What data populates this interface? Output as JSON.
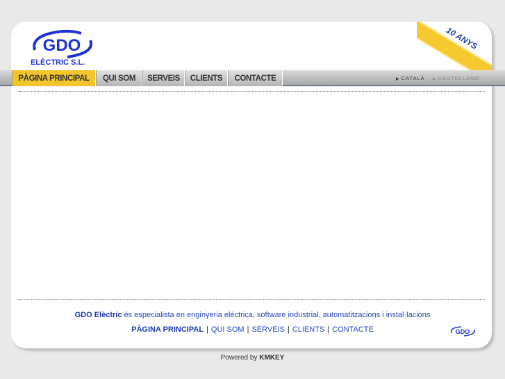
{
  "brand": {
    "logo_text": "GDO",
    "subtitle": "ELÈCTRIC S.L.",
    "ribbon": "10 ANYS"
  },
  "nav": {
    "items": [
      {
        "label": "PÀGINA PRINCIPAL",
        "active": true
      },
      {
        "label": "QUI SOM"
      },
      {
        "label": "SERVEIS"
      },
      {
        "label": "CLIENTS"
      },
      {
        "label": "CONTACTE"
      }
    ]
  },
  "languages": [
    {
      "label": "CATALÀ",
      "active": true
    },
    {
      "label": "CASTELLANO"
    }
  ],
  "footer": {
    "brand_name": "GDO Elèctric",
    "description": " és especialista en enginyeria eléctrica, software industrial, automatitzacions i instal·lacions",
    "links": [
      "PÀGINA PRINCIPAL",
      "QUI SOM",
      "SERVEIS",
      "CLIENTS",
      "CONTACTE"
    ],
    "separator": "|",
    "small_logo": "GDO"
  },
  "powered": {
    "prefix": "Powered by ",
    "name": "KMKEY"
  },
  "colors": {
    "accent": "#f2c52c",
    "brand_blue": "#1a3ab0"
  }
}
